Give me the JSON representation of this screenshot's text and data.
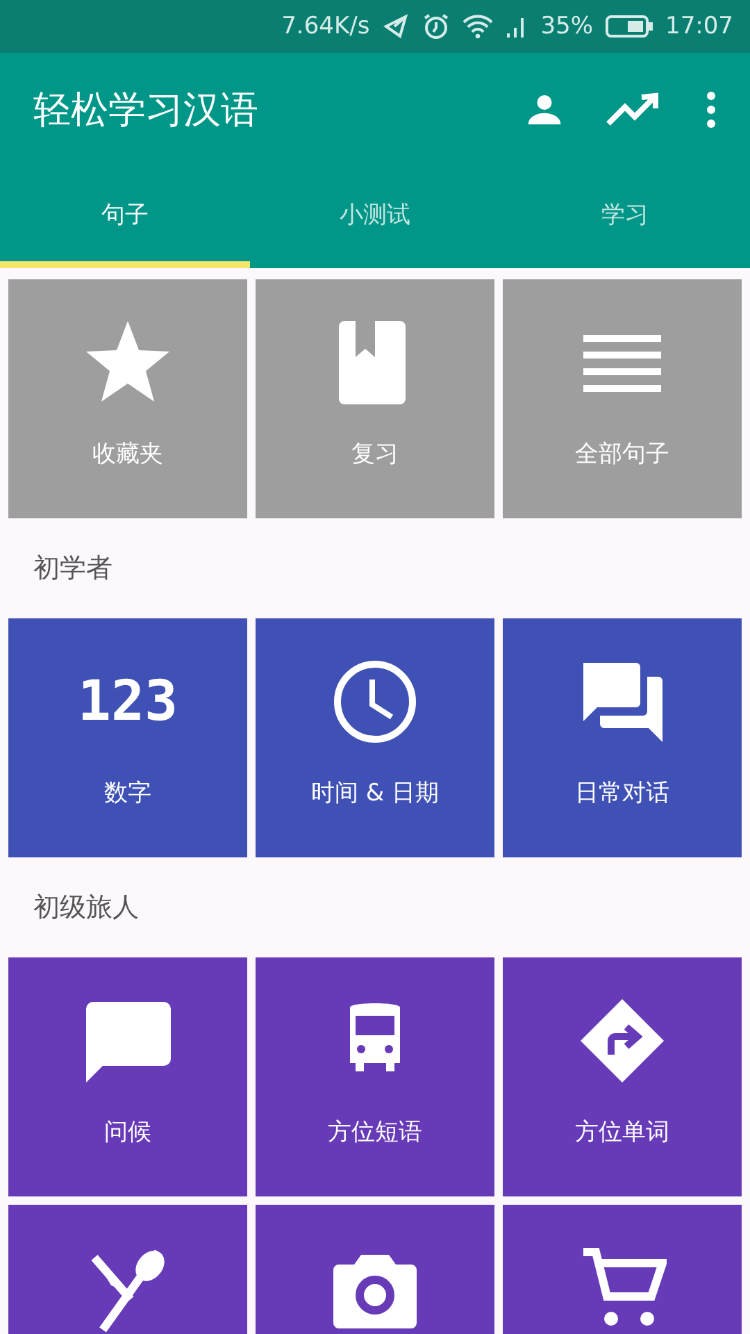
{
  "status_bar": {
    "speed": "7.64K/s",
    "battery": "35%",
    "time": "17:07"
  },
  "app_bar": {
    "title": "轻松学习汉语"
  },
  "tabs": [
    {
      "label": "句子",
      "selected": true
    },
    {
      "label": "小测试",
      "selected": false
    },
    {
      "label": "学习",
      "selected": false
    }
  ],
  "sections": [
    {
      "color": "#9e9e9e",
      "tiles": [
        {
          "kind": "star",
          "label": "收藏夹"
        },
        {
          "kind": "bookmark",
          "label": "复习"
        },
        {
          "kind": "list",
          "label": "全部句子"
        }
      ]
    },
    {
      "title": "初学者",
      "color": "#3f51b5",
      "tiles": [
        {
          "kind": "digits",
          "glyph": "123",
          "label": "数字"
        },
        {
          "kind": "clock",
          "label": "时间 & 日期"
        },
        {
          "kind": "chats",
          "label": "日常对话"
        }
      ]
    },
    {
      "title": "初级旅人",
      "color": "#673ab7",
      "tiles": [
        {
          "kind": "bubble",
          "label": "问候"
        },
        {
          "kind": "bus",
          "label": "方位短语"
        },
        {
          "kind": "sign",
          "label": "方位单词"
        },
        {
          "kind": "cutlery"
        },
        {
          "kind": "camera"
        },
        {
          "kind": "cart"
        }
      ]
    }
  ]
}
